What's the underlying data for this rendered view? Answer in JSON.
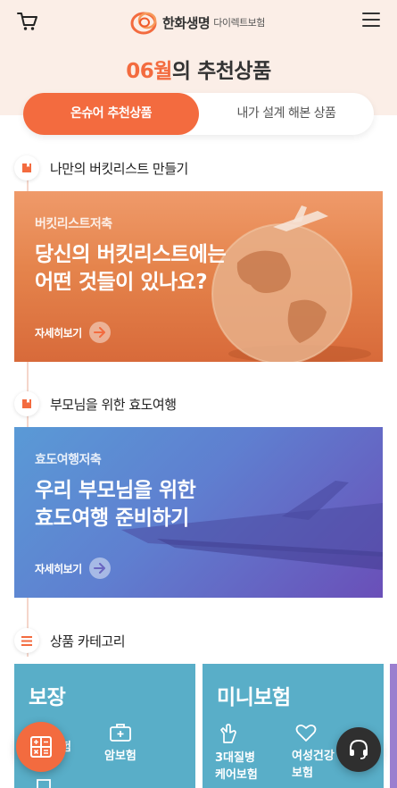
{
  "header": {
    "logo_text": "한화생명",
    "logo_sub": "다이렉트보험",
    "icons": [
      "cart-icon",
      "hamburger-menu-icon"
    ]
  },
  "title": {
    "month": "06월",
    "rest": "의 추천상품"
  },
  "tabs": [
    {
      "label": "온슈어 추천상품",
      "active": true
    },
    {
      "label": "내가 설계 해본 상품",
      "active": false
    }
  ],
  "sections": [
    {
      "title": "나만의 버킷리스트 만들기",
      "icon": "bookmark-icon"
    },
    {
      "title": "부모님을 위한 효도여행",
      "icon": "bookmark-icon"
    },
    {
      "title": "상품 카테고리",
      "icon": "list-icon"
    }
  ],
  "banners": [
    {
      "kicker": "버킷리스트저축",
      "line1": "당신의 버킷리스트에는",
      "line2": "어떤 것들이 있나요?",
      "more": "자세히보기"
    },
    {
      "kicker": "효도여행저축",
      "line1": "우리 부모님을 위한",
      "line2": "효도여행 준비하기",
      "more": "자세히보기"
    }
  ],
  "categories": [
    {
      "title": "보장",
      "items": [
        {
          "line1": "보험",
          "line2": ""
        },
        {
          "line1": "암보험",
          "line2": ""
        }
      ]
    },
    {
      "title": "미니보험",
      "items": [
        {
          "line1": "3대질병",
          "line2": "케어보험"
        },
        {
          "line1": "여성건강",
          "line2": "보험"
        }
      ]
    }
  ],
  "colors": {
    "accent": "#f36b3f",
    "header_bg": "#fbeee7",
    "card_bg": "#59aec8",
    "support_button": "#2f2f2f"
  }
}
